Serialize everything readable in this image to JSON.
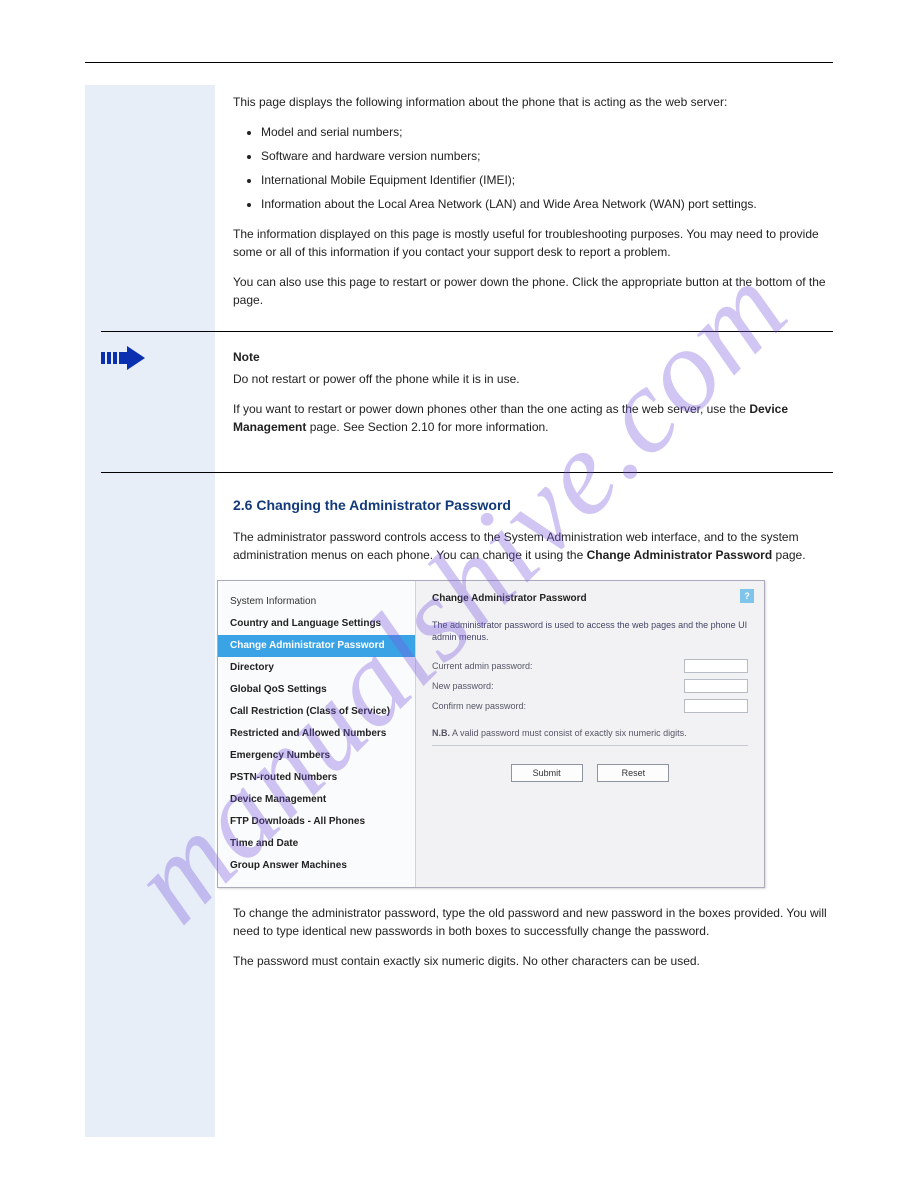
{
  "intro": {
    "p1": "This page displays the following information about the phone that is acting as the web server:",
    "bullets": [
      "Model and serial numbers;",
      "Software and hardware version numbers;",
      "International Mobile Equipment Identifier (IMEI);",
      "Information about the Local Area Network (LAN) and Wide Area Network (WAN) port settings."
    ],
    "p2": "The information displayed on this page is mostly useful for troubleshooting purposes. You may need to provide some or all of this information if you contact your support desk to report a problem.",
    "p3": "You can also use this page to restart or power down the phone. Click the appropriate button at the bottom of the page."
  },
  "note": {
    "label": "Note",
    "line1": "Do not restart or power off the phone while it is in use.",
    "line2": "If you want to restart or power down phones other than the one acting as the web server, use the",
    "emph": "Device Management",
    "line3": "page. See Section 2.10 for more information."
  },
  "section": {
    "heading": "2.6 Changing the Administrator Password",
    "p1_a": "The administrator password controls access to the System Administration web interface, and to the system administration menus on each phone. You can change it using the",
    "emph": "Change Administrator Password",
    "p1_b": "page.",
    "p2": "To change the administrator password, type the old password and new password in the boxes provided. You will need to type identical new passwords in both boxes to successfully change the password.",
    "p3": "The password must contain exactly six numeric digits. No other characters can be used."
  },
  "figure": {
    "nav": {
      "items": [
        "System Information",
        "Country and Language Settings",
        "Change Administrator Password",
        "Directory",
        "Global QoS Settings",
        "Call Restriction (Class of Service)",
        "Restricted and Allowed Numbers",
        "Emergency Numbers",
        "PSTN-routed Numbers",
        "Device Management",
        "FTP Downloads - All Phones",
        "Time and Date",
        "Group Answer Machines"
      ],
      "selected_index": 2
    },
    "panel": {
      "title": "Change Administrator Password",
      "help": "?",
      "desc": "The administrator password is used to access the web pages and the phone UI admin menus.",
      "fields": {
        "current": "Current admin password:",
        "new": "New password:",
        "confirm": "Confirm new password:"
      },
      "nb_prefix": "N.B.",
      "nb_text": "A valid password must consist of exactly six numeric digits.",
      "buttons": {
        "submit": "Submit",
        "reset": "Reset"
      }
    }
  }
}
